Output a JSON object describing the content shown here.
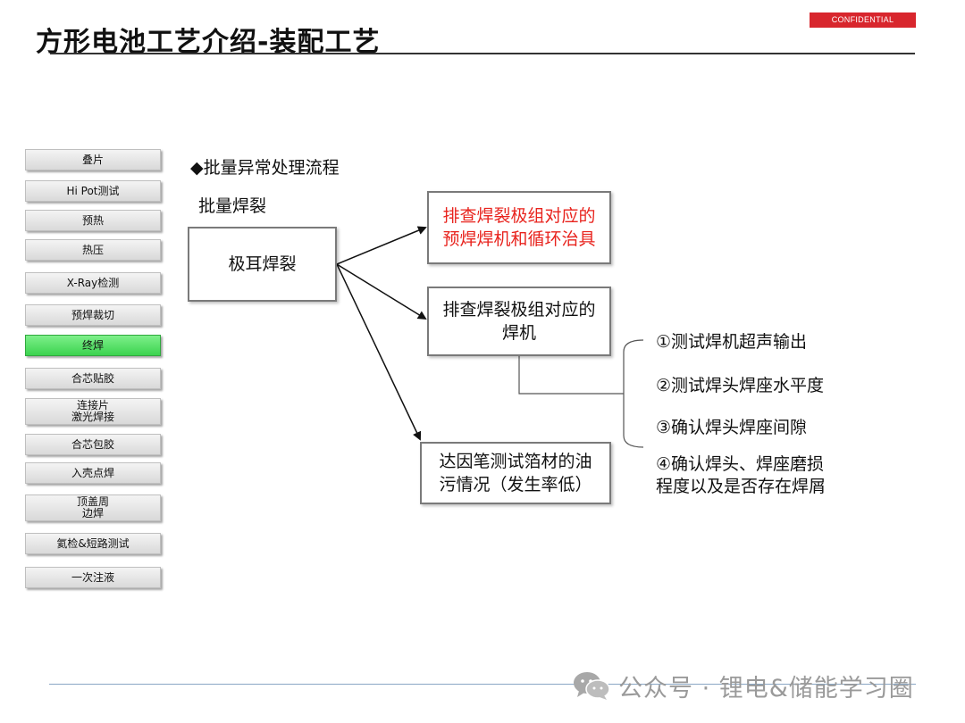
{
  "header": {
    "title": "方形电池工艺介绍-装配工艺",
    "badge": "CONFIDENTIAL"
  },
  "process_steps": [
    {
      "label": "叠片",
      "active": false
    },
    {
      "label": "Hi Pot测试",
      "active": false
    },
    {
      "label": "预热",
      "active": false
    },
    {
      "label": "热压",
      "active": false
    },
    {
      "label": "X-Ray检测",
      "active": false
    },
    {
      "label": "预焊裁切",
      "active": false
    },
    {
      "label": "终焊",
      "active": true
    },
    {
      "label": "合芯贴胶",
      "active": false
    },
    {
      "label": "连接片\n激光焊接",
      "active": false
    },
    {
      "label": "合芯包胶",
      "active": false
    },
    {
      "label": "入壳点焊",
      "active": false
    },
    {
      "label": "顶盖周\n边焊",
      "active": false
    },
    {
      "label": "氦检&短路测试",
      "active": false
    },
    {
      "label": "一次注液",
      "active": false
    }
  ],
  "content": {
    "flow_heading": "◆批量异常处理流程",
    "case_heading": "批量焊裂",
    "root_box": "极耳焊裂",
    "branch_boxes": [
      {
        "lines": [
          "排查焊裂极组对应的",
          "预焊焊机和循环治具"
        ],
        "highlight": true
      },
      {
        "lines": [
          "排查焊裂极组对应的",
          "焊机"
        ],
        "highlight": false
      },
      {
        "lines": [
          "达因笔测试箔材的油",
          "污情况（发生率低）"
        ],
        "highlight": false
      }
    ],
    "checklist": [
      {
        "lines": [
          "①测试焊机超声输出"
        ]
      },
      {
        "lines": [
          "②测试焊头焊座水平度"
        ]
      },
      {
        "lines": [
          "③确认焊头焊座间隙"
        ]
      },
      {
        "lines": [
          "④确认焊头、焊座磨损",
          "程度以及是否存在焊屑"
        ]
      }
    ]
  },
  "footer": {
    "watermark": "公众号 · 锂电&储能学习圈"
  },
  "colors": {
    "highlight_text": "#e8231d",
    "active_step": "#3bd34f",
    "badge": "#d8262d"
  }
}
